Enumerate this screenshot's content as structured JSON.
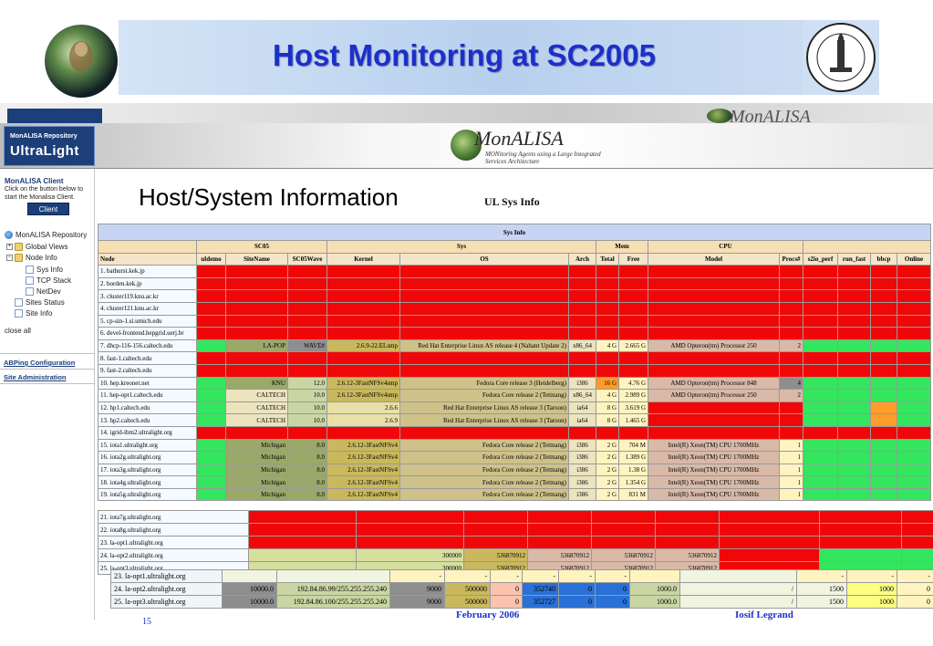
{
  "slide": {
    "title": "Host Monitoring at SC2005",
    "page_number": "15",
    "date": "February     2006",
    "author": "Iosif Legrand"
  },
  "banner": {
    "repo_line1": "MonALISA Repository",
    "repo_line2": "UltraLight",
    "brand": "MonALISA",
    "tagline": "MONitoring Agents using a Large Integrated Services Architecture"
  },
  "sidebar": {
    "client_title": "MonALISA Client",
    "client_desc": "Click on the button below to start the Monalisa Client.",
    "client_button": "Client",
    "tree": [
      "MonALISA Repository",
      "Global Views",
      "Node Info",
      "Sys Info",
      "TCP Stack",
      "NetDev",
      "Sites Status",
      "Site Info"
    ],
    "close_all": "close all",
    "links": [
      "ABPing Configuration",
      "Site Administration"
    ]
  },
  "main": {
    "heading": "Host/System Information",
    "subheading": "UL Sys Info"
  },
  "sys_table": {
    "caption": "Sys Info",
    "groups": [
      "SC05",
      "Sys",
      "Mem",
      "CPU"
    ],
    "columns": [
      "Node",
      "uldemo",
      "SiteName",
      "SC05Wave",
      "Kernel",
      "OS",
      "Arch",
      "Total",
      "Free",
      "Model",
      "Procs#",
      "s2io_perf",
      "run_fast",
      "bbcp",
      "Online"
    ],
    "rows": [
      {
        "node": "1. bathurst.kek.jp"
      },
      {
        "node": "2. borden.kek.jp"
      },
      {
        "node": "3. cluster119.knu.ac.kr"
      },
      {
        "node": "4. cluster121.knu.ac.kr"
      },
      {
        "node": "5. cp-sin-1.si.umich.edu"
      },
      {
        "node": "6. devel-frontend.hepgrid.uerj.br"
      },
      {
        "node": "7. dhcp-116-156.caltech.edu",
        "site": "LA-POP",
        "wave": "WAVE#",
        "kernel": "2.6.9-22.ELsmp",
        "os": "Red Hat Enterprise Linux AS release 4 (Nahant Update 2)",
        "arch": "x86_64",
        "total": "4 G",
        "free": "2.665 G",
        "model": "AMD Opteron(tm) Processor 250",
        "procs": "2"
      },
      {
        "node": "8. fast-1.caltech.edu"
      },
      {
        "node": "9. fast-2.caltech.edu"
      },
      {
        "node": "10. hep.kreonet.net",
        "site": "KNU",
        "wave": "12.0",
        "kernel": "2.6.12-3FastNFSv4smp",
        "os": "Fedora Core release 3 (Heidelberg)",
        "arch": "i386",
        "total": "16 G",
        "free": "4.76 G",
        "model": "AMD Opteron(tm) Processor 848",
        "procs": "4"
      },
      {
        "node": "11. hep-opt1.caltech.edu",
        "site": "CALTECH",
        "wave": "10.0",
        "kernel": "2.6.12-3FastNFSv4smp",
        "os": "Fedora Core release 2 (Tettnang)",
        "arch": "x86_64",
        "total": "4 G",
        "free": "2.989 G",
        "model": "AMD Opteron(tm) Processor 250",
        "procs": "2"
      },
      {
        "node": "12. hp1.caltech.edu",
        "site": "CALTECH",
        "wave": "10.0",
        "kernel": "2.6.6",
        "os": "Red Hat Enterprise Linux AS release 3 (Taroon)",
        "arch": "ia64",
        "total": "8 G",
        "free": "3.619 G",
        "model": "",
        "procs": ""
      },
      {
        "node": "13. hp2.caltech.edu",
        "site": "CALTECH",
        "wave": "10.0",
        "kernel": "2.6.9",
        "os": "Red Hat Enterprise Linux AS release 3 (Taroon)",
        "arch": "ia64",
        "total": "8 G",
        "free": "1.465 G",
        "model": "",
        "procs": ""
      },
      {
        "node": "14. igrid-ibm2.ultralight.org"
      },
      {
        "node": "15. iota1.ultralight.org",
        "site": "Michigan",
        "wave": "8.0",
        "kernel": "2.6.12-3FastNFSv4",
        "os": "Fedora Core release 2 (Tettnang)",
        "arch": "i386",
        "total": "2 G",
        "free": "704 M",
        "model": "Intel(R) Xeon(TM) CPU 1700MHz",
        "procs": "1"
      },
      {
        "node": "16. iota2g.ultralight.org",
        "site": "Michigan",
        "wave": "8.0",
        "kernel": "2.6.12-3FastNFSv4",
        "os": "Fedora Core release 2 (Tettnang)",
        "arch": "i386",
        "total": "2 G",
        "free": "1.389 G",
        "model": "Intel(R) Xeon(TM) CPU 1700MHz",
        "procs": "1"
      },
      {
        "node": "17. iota3g.ultralight.org",
        "site": "Michigan",
        "wave": "8.0",
        "kernel": "2.6.12-3FastNFSv4",
        "os": "Fedora Core release 2 (Tettnang)",
        "arch": "i386",
        "total": "2 G",
        "free": "1.38 G",
        "model": "Intel(R) Xeon(TM) CPU 1700MHz",
        "procs": "1"
      },
      {
        "node": "18. iota4g.ultralight.org",
        "site": "Michigan",
        "wave": "8.0",
        "kernel": "2.6.12-3FastNFSv4",
        "os": "Fedora Core release 2 (Tettnang)",
        "arch": "i386",
        "total": "2 G",
        "free": "1.354 G",
        "model": "Intel(R) Xeon(TM) CPU 1700MHz",
        "procs": "1"
      },
      {
        "node": "19. iota5g.ultralight.org",
        "site": "Michigan",
        "wave": "8.0",
        "kernel": "2.6.12-3FastNFSv4",
        "os": "Fedora Core release 2 (Tettnang)",
        "arch": "i386",
        "total": "2 G",
        "free": "831 M",
        "model": "Intel(R) Xeon(TM) CPU 1700MHz",
        "procs": "1"
      }
    ]
  },
  "overlay_table": {
    "rows": [
      {
        "node": "21. iota7g.ultralight.org"
      },
      {
        "node": "22. iota8g.ultralight.org"
      },
      {
        "node": "23. la-opt1.ultralight.org"
      },
      {
        "node": "24. la-opt2.ultralight.org",
        "v1": "300000",
        "v2": "536870912",
        "v3": "536870912",
        "v4": "536870912",
        "v5": "536870912"
      },
      {
        "node": "25. la-opt3.ultralight.org",
        "v1": "300000",
        "v2": "536870912",
        "v3": "536870912",
        "v4": "536870912",
        "v5": "536870912"
      }
    ]
  },
  "bottom_table": {
    "rows": [
      {
        "node": "23. la-opt1.ultralight.org",
        "a": "",
        "b": "",
        "c": "-",
        "d": "-",
        "e": "-",
        "f": "-",
        "g": "-",
        "h": "-",
        "i": "",
        "j": "",
        "k": "-",
        "l": "-",
        "m": "-"
      },
      {
        "node": "24. la-opt2.ultralight.org",
        "a": "10000.0",
        "b": "192.84.86.99/255.255.255.240",
        "c": "9000",
        "d": "500000",
        "e": "0",
        "f": "352740",
        "g": "0",
        "h": "0",
        "i": "1000.0",
        "j": "/",
        "k": "1500",
        "l": "1000",
        "m": "0"
      },
      {
        "node": "25. la-opt3.ultralight.org",
        "a": "10000.0",
        "b": "192.84.86.100/255.255.255.240",
        "c": "9000",
        "d": "500000",
        "e": "0",
        "f": "352727",
        "g": "0",
        "h": "0",
        "i": "1000.0",
        "j": "/",
        "k": "1500",
        "l": "1000",
        "m": "0"
      }
    ]
  },
  "colors": {
    "title_blue": "#1d2fc9",
    "status_red": "#f00808",
    "status_green": "#33e65e",
    "status_orange": "#ff9c2a",
    "repo_navy": "#1c3f7a"
  }
}
